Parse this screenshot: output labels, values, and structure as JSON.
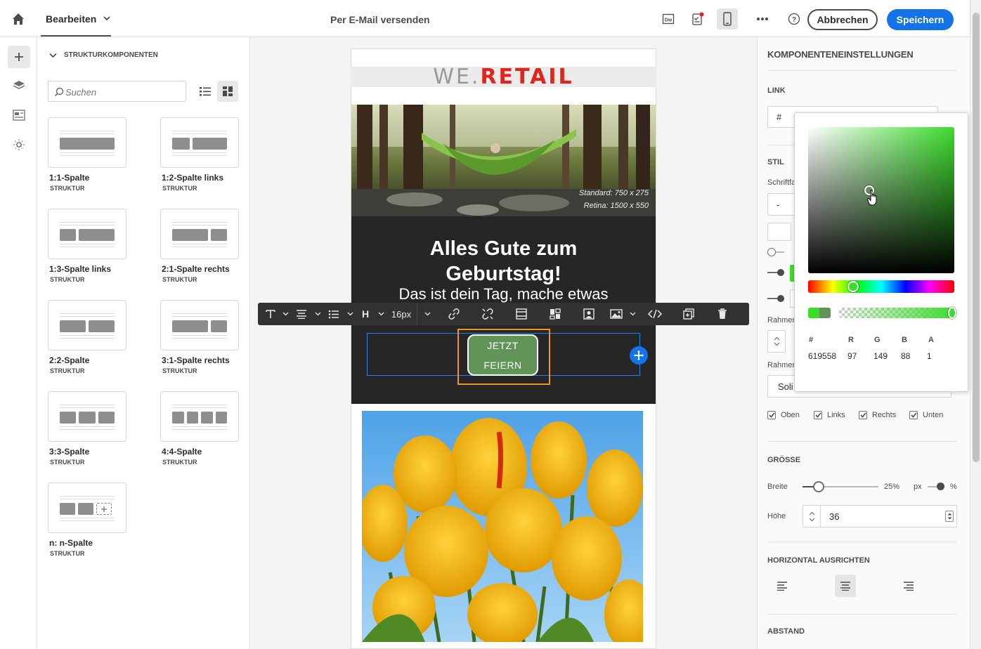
{
  "header": {
    "mode_label": "Bearbeiten",
    "title": "Per E-Mail versenden",
    "cancel_label": "Abbrechen",
    "save_label": "Speichern",
    "icons": [
      "home-icon",
      "dreamweaver-icon",
      "checklist-icon",
      "mobile-preview-icon",
      "more-icon",
      "help-icon"
    ]
  },
  "rail": {
    "items": [
      "add-icon",
      "layers-icon",
      "fragments-icon",
      "settings-icon"
    ]
  },
  "components": {
    "heading": "STRUKTURKOMPONENTEN",
    "search_placeholder": "Suchen",
    "items": [
      {
        "name": "1:1-Spalte",
        "type": "STRUKTUR"
      },
      {
        "name": "1:2-Spalte links",
        "type": "STRUKTUR"
      },
      {
        "name": "1:3-Spalte links",
        "type": "STRUKTUR"
      },
      {
        "name": "2:1-Spalte rechts",
        "type": "STRUKTUR"
      },
      {
        "name": "2:2-Spalte",
        "type": "STRUKTUR"
      },
      {
        "name": "3:1-Spalte rechts",
        "type": "STRUKTUR"
      },
      {
        "name": "3:3-Spalte",
        "type": "STRUKTUR"
      },
      {
        "name": "4:4-Spalte",
        "type": "STRUKTUR"
      },
      {
        "name": "n: n-Spalte",
        "type": "STRUKTUR"
      }
    ]
  },
  "email": {
    "logo_we": "WE.",
    "logo_retail": "RETAIL",
    "hero_note_1": "Standard: 750 x 275",
    "hero_note_2": "Retina: 1500 x 550",
    "headline_1": "Alles Gute zum",
    "headline_2": "Geburtstag!",
    "subline": "Das ist dein Tag, mache etwas",
    "cta_1": "JETZT",
    "cta_2": "FEIERN"
  },
  "toolbar": {
    "font_size": "16px",
    "heading": "H"
  },
  "settings": {
    "title": "KOMPONENTENEINSTELLUNGEN",
    "link_section": "LINK",
    "link_value": "#",
    "style_section": "STIL",
    "font_label": "Schriftfa",
    "font_value": "-",
    "border_label_1": "Rahmen",
    "border_label_2": "Rahmen",
    "border_style": "Soli",
    "checks": [
      "Oben",
      "Links",
      "Rechts",
      "Unten"
    ],
    "size_section": "GRÖSSE",
    "width_label": "Breite",
    "width_value": "25%",
    "unit_px": "px",
    "unit_pct": "%",
    "height_label": "Höhe",
    "height_value": "36",
    "align_section": "HORIZONTAL AUSRICHTEN",
    "spacing_section": "ABSTAND"
  },
  "color_picker": {
    "labels": {
      "hex": "#",
      "r": "R",
      "g": "G",
      "b": "B",
      "a": "A"
    },
    "values": {
      "hex": "619558",
      "r": "97",
      "g": "149",
      "b": "88",
      "a": "1"
    },
    "current_color": "#619558",
    "hue_color": "#3cdc2c"
  },
  "colors": {
    "accent": "#1473e6",
    "selection_orange": "#f29423",
    "cta": "#619558",
    "brand_red": "#e1251b"
  }
}
